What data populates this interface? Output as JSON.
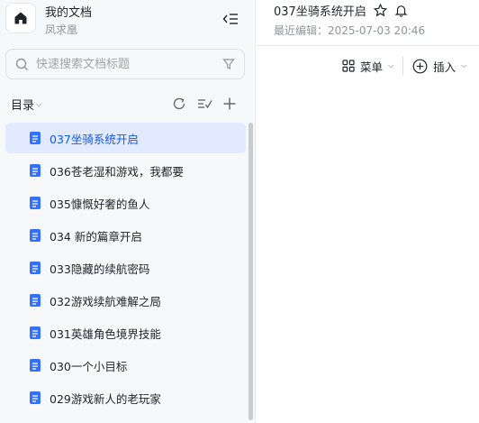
{
  "workspace": {
    "title": "我的文档",
    "owner": "凤求凰"
  },
  "search": {
    "placeholder": "快速搜索文档标题"
  },
  "toc": {
    "label": "目录",
    "caret": "⌵"
  },
  "documents": [
    {
      "title": "037坐骑系统开启",
      "active": true
    },
    {
      "title": "036苍老湿和游戏，我都要",
      "active": false
    },
    {
      "title": "035慷慨好奢的鱼人",
      "active": false
    },
    {
      "title": "034 新的篇章开启",
      "active": false
    },
    {
      "title": "033隐藏的续航密码",
      "active": false
    },
    {
      "title": "032游戏续航难解之局",
      "active": false
    },
    {
      "title": "031英雄角色境界技能",
      "active": false
    },
    {
      "title": "030一个小目标",
      "active": false
    },
    {
      "title": "029游戏新人的老玩家",
      "active": false
    }
  ],
  "main": {
    "title": "037坐骑系统开启",
    "last_edit": "最近编辑：2025-07-03 20:46"
  },
  "toolbar": {
    "menu_label": "菜单",
    "insert_label": "插入",
    "caret": "⌵"
  },
  "colors": {
    "accent": "#1456f0",
    "doc_icon": "#3370ff",
    "active_bg": "#e1eaff",
    "sidebar_bg": "#f7f8fa"
  }
}
